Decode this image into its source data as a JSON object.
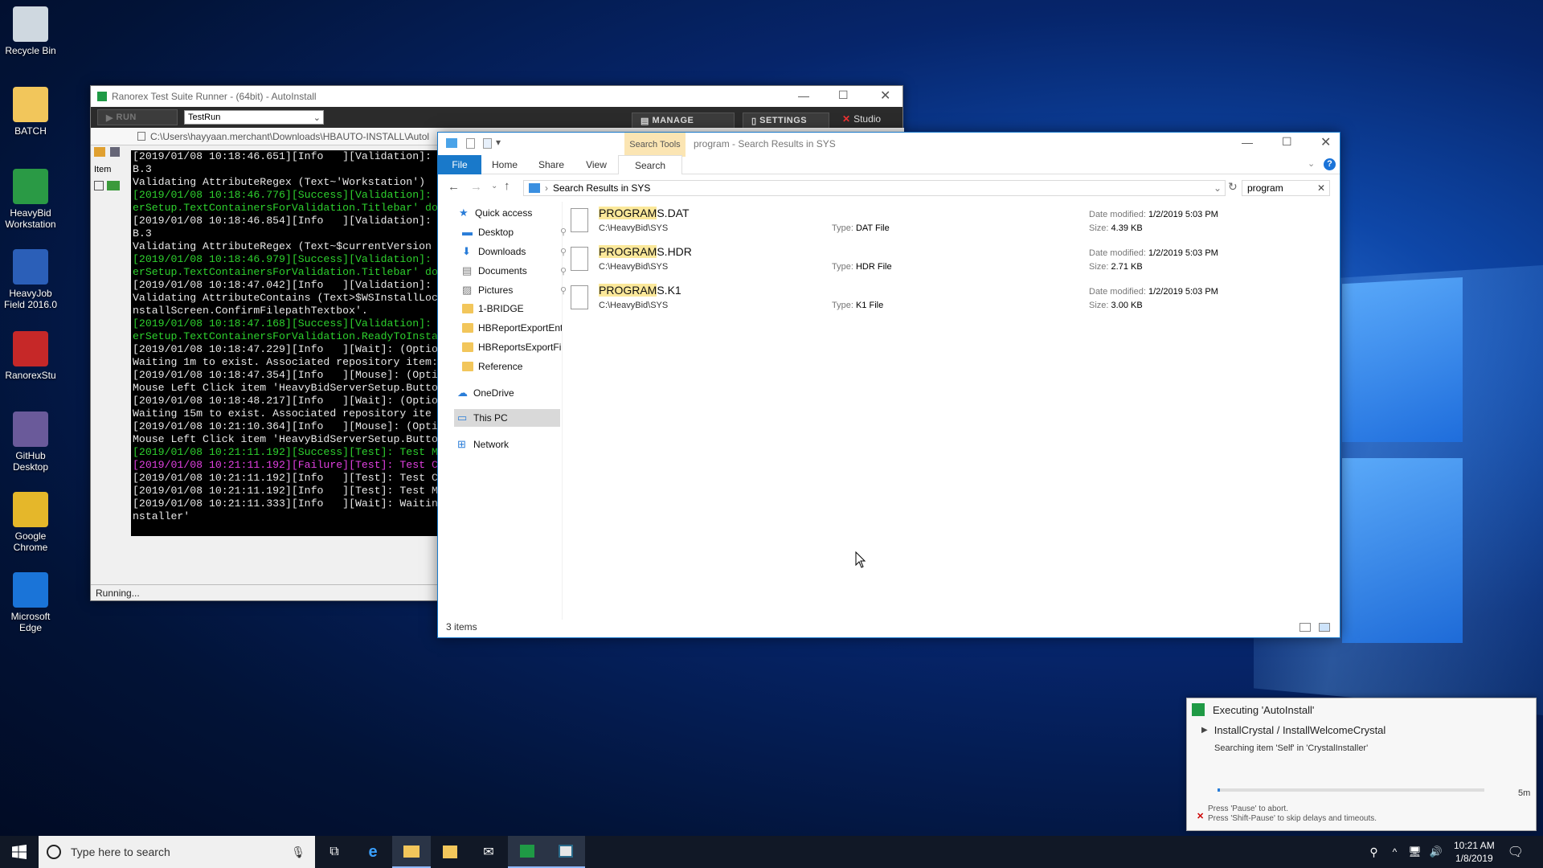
{
  "desktop": {
    "icons": [
      {
        "label": "Recycle Bin",
        "icon": "recycle-bin-icon"
      },
      {
        "label": "BATCH",
        "icon": "folder-icon"
      },
      {
        "label": "HeavyBid Workstation",
        "icon": "heavybid-icon"
      },
      {
        "label": "HeavyJob Field 2016.0",
        "icon": "heavyjob-icon"
      },
      {
        "label": "RanorexStu",
        "icon": "ranorex-icon"
      },
      {
        "label": "GitHub Desktop",
        "icon": "github-icon"
      },
      {
        "label": "Google Chrome",
        "icon": "chrome-icon"
      },
      {
        "label": "Microsoft Edge",
        "icon": "edge-icon"
      }
    ]
  },
  "ranorex": {
    "title": "Ranorex Test Suite Runner - (64bit) - AutoInstall",
    "run_label": "RUN",
    "config_value": "TestRun",
    "manage_label": "MANAGE",
    "settings_label": "SETTINGS",
    "studio_label": "Studio",
    "path": "C:\\Users\\hayyaan.merchant\\Downloads\\HBAUTO-INSTALL\\Autol",
    "item_col": "Item",
    "status": "Running..."
  },
  "console": {
    "lines": [
      {
        "t": "[2019/01/08 10:18:46.651][Info   ][Validation]:",
        "c": "white"
      },
      {
        "t": "B.3",
        "c": "white"
      },
      {
        "t": "Validating AttributeRegex (Text~'Workstation')",
        "c": "white"
      },
      {
        "t": "[2019/01/08 10:18:46.776][Success][Validation]:",
        "c": "green"
      },
      {
        "t": "erSetup.TextContainersForValidation.Titlebar' do",
        "c": "green"
      },
      {
        "t": "[2019/01/08 10:18:46.854][Info   ][Validation]:",
        "c": "white"
      },
      {
        "t": "B.3",
        "c": "white"
      },
      {
        "t": "Validating AttributeRegex (Text~$currentVersion",
        "c": "white"
      },
      {
        "t": "[2019/01/08 10:18:46.979][Success][Validation]:",
        "c": "green"
      },
      {
        "t": "erSetup.TextContainersForValidation.Titlebar' do",
        "c": "green"
      },
      {
        "t": "[2019/01/08 10:18:47.042][Info   ][Validation]:",
        "c": "white"
      },
      {
        "t": "Validating AttributeContains (Text>$WSInstallLoc",
        "c": "white"
      },
      {
        "t": "nstallScreen.ConfirmFilepathTextbox'.",
        "c": "white"
      },
      {
        "t": "[2019/01/08 10:18:47.168][Success][Validation]:",
        "c": "green"
      },
      {
        "t": "erSetup.TextContainersForValidation.ReadyToInsta",
        "c": "green"
      },
      {
        "t": "[2019/01/08 10:18:47.229][Info   ][Wait]: (Optio",
        "c": "white"
      },
      {
        "t": "Waiting 1m to exist. Associated repository item:",
        "c": "white"
      },
      {
        "t": "[2019/01/08 10:18:47.354][Info   ][Mouse]: (Opti",
        "c": "white"
      },
      {
        "t": "Mouse Left Click item 'HeavyBidServerSetup.Butto",
        "c": "white"
      },
      {
        "t": "[2019/01/08 10:18:48.217][Info   ][Wait]: (Optio",
        "c": "white"
      },
      {
        "t": "Waiting 15m to exist. Associated repository ite",
        "c": "white"
      },
      {
        "t": "[2019/01/08 10:21:10.364][Info   ][Mouse]: (Opti",
        "c": "white"
      },
      {
        "t": "Mouse Left Click item 'HeavyBidServerSetup.Butto",
        "c": "white"
      },
      {
        "t": "[2019/01/08 10:21:11.192][Success][Test]: Test M",
        "c": "green"
      },
      {
        "t": "[2019/01/08 10:21:11.192][Failure][Test]: Test C",
        "c": "mag"
      },
      {
        "t": "[2019/01/08 10:21:11.192][Info   ][Test]: Test C",
        "c": "white"
      },
      {
        "t": "[2019/01/08 10:21:11.192][Info   ][Test]: Test M",
        "c": "white"
      },
      {
        "t": "[2019/01/08 10:21:11.333][Info   ][Wait]: Waitin",
        "c": "white"
      },
      {
        "t": "nstaller'",
        "c": "white"
      }
    ]
  },
  "explorer": {
    "title": "program - Search Results in SYS",
    "search_tools": "Search Tools",
    "tabs": [
      "File",
      "Home",
      "Share",
      "View",
      "Search"
    ],
    "address": "Search Results in SYS",
    "search_value": "program",
    "nav": [
      {
        "label": "Quick access",
        "icon": "star-icon",
        "pin": false
      },
      {
        "label": "Desktop",
        "icon": "desktop-icon",
        "pin": true
      },
      {
        "label": "Downloads",
        "icon": "download-icon",
        "pin": true
      },
      {
        "label": "Documents",
        "icon": "documents-icon",
        "pin": true
      },
      {
        "label": "Pictures",
        "icon": "pictures-icon",
        "pin": true
      },
      {
        "label": "1-BRIDGE",
        "icon": "folder-icon",
        "pin": false
      },
      {
        "label": "HBReportExportEnt",
        "icon": "folder-icon",
        "pin": false
      },
      {
        "label": "HBReportsExportFil",
        "icon": "folder-icon",
        "pin": false
      },
      {
        "label": "Reference",
        "icon": "folder-icon",
        "pin": false
      },
      {
        "label": "OneDrive",
        "icon": "cloud-icon",
        "pin": false
      },
      {
        "label": "This PC",
        "icon": "pc-icon",
        "pin": false
      },
      {
        "label": "Network",
        "icon": "network-icon",
        "pin": false
      }
    ],
    "files": [
      {
        "name_hl": "PROGRAM",
        "name_rest": "S.DAT",
        "path": "C:\\HeavyBid\\SYS",
        "type_label": "Type:",
        "type": "DAT File",
        "date_label": "Date modified:",
        "date": "1/2/2019 5:03 PM",
        "size_label": "Size:",
        "size": "4.39 KB"
      },
      {
        "name_hl": "PROGRAM",
        "name_rest": "S.HDR",
        "path": "C:\\HeavyBid\\SYS",
        "type_label": "Type:",
        "type": "HDR File",
        "date_label": "Date modified:",
        "date": "1/2/2019 5:03 PM",
        "size_label": "Size:",
        "size": "2.71 KB"
      },
      {
        "name_hl": "PROGRAM",
        "name_rest": "S.K1",
        "path": "C:\\HeavyBid\\SYS",
        "type_label": "Type:",
        "type": "K1 File",
        "date_label": "Date modified:",
        "date": "1/2/2019 5:03 PM",
        "size_label": "Size:",
        "size": "3.00 KB"
      }
    ],
    "status": "3 items"
  },
  "notification": {
    "title": "Executing 'AutoInstall'",
    "step": "InstallCrystal / InstallWelcomeCrystal",
    "detail": "Searching item 'Self' in 'CrystalInstaller'",
    "timeout": "5m",
    "progress": 0.01,
    "hint1": "Press 'Pause' to abort.",
    "hint2": "Press 'Shift-Pause' to skip delays and timeouts."
  },
  "taskbar": {
    "search_placeholder": "Type here to search",
    "time": "10:21 AM",
    "date": "1/8/2019"
  }
}
